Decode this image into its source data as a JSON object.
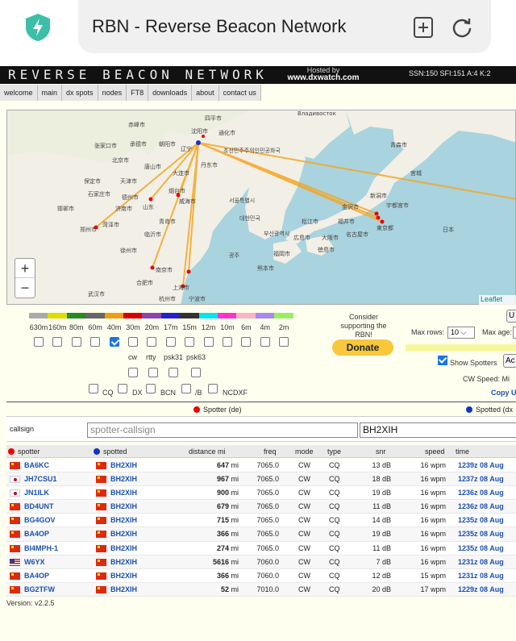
{
  "browser": {
    "title": "RBN - Reverse Beacon Network",
    "icons": {
      "shield": "shield-lightning-icon",
      "add_tab": "add-tab-icon",
      "reload": "reload-icon"
    }
  },
  "header": {
    "logo": "REVERSE BEACON NETWORK",
    "hosted_by": "Hosted by",
    "host": "www.dxwatch.com",
    "ssn": "SSN:150 SFI:151 A:4 K:2"
  },
  "nav": [
    "welcome",
    "main",
    "dx spots",
    "nodes",
    "FT8",
    "downloads",
    "about",
    "contact us"
  ],
  "map": {
    "zoom_in": "+",
    "zoom_out": "−",
    "attribution": "Leaflet",
    "places": [
      "赤峰市",
      "四平市",
      "沈阳市",
      "通化市",
      "承德市",
      "朝阳市",
      "张家口市",
      "北京市",
      "辽宁",
      "丹东市",
      "大连市",
      "唐山市",
      "天津市",
      "保定市",
      "石家庄市",
      "德州市",
      "济南市",
      "山东",
      "烟台市",
      "威海市",
      "青岛市",
      "邯郸市",
      "菏泽市",
      "临沂市",
      "郑州市",
      "徐州市",
      "南京市",
      "合肥市",
      "上海市",
      "杭州市",
      "宁波市",
      "武汉市",
      "서울특별시",
      "대한민국",
      "광주",
      "부산광역시",
      "新潟市",
      "金沢市",
      "福井市",
      "名古屋市",
      "東京都",
      "宇都宮市",
      "大阪市",
      "広島市",
      "熊本市",
      "福岡市",
      "松江市",
      "徳島市",
      "青森市",
      "宮城",
      "日本",
      "Владивосток",
      "조선민주주의인민공화국"
    ]
  },
  "bands": [
    {
      "label": "630m",
      "color": "#aaaaaa",
      "checked": false
    },
    {
      "label": "160m",
      "color": "#dddd00",
      "checked": false
    },
    {
      "label": "80m",
      "color": "#228b22",
      "checked": false
    },
    {
      "label": "60m",
      "color": "#666666",
      "checked": false
    },
    {
      "label": "40m",
      "color": "#f39c12",
      "checked": true
    },
    {
      "label": "30m",
      "color": "#dd0000",
      "checked": false
    },
    {
      "label": "20m",
      "color": "#8e44ad",
      "checked": false
    },
    {
      "label": "17m",
      "color": "#2222cc",
      "checked": false
    },
    {
      "label": "15m",
      "color": "#333333",
      "checked": false
    },
    {
      "label": "12m",
      "color": "#00e5ee",
      "checked": false
    },
    {
      "label": "10m",
      "color": "#ff33cc",
      "checked": false
    },
    {
      "label": "6m",
      "color": "#f7b6c2",
      "checked": false
    },
    {
      "label": "4m",
      "color": "#aa88ee",
      "checked": false
    },
    {
      "label": "2m",
      "color": "#99ee66",
      "checked": false
    }
  ],
  "modes": [
    "cw",
    "rtty",
    "psk31",
    "psk63"
  ],
  "options": [
    "CQ",
    "DX",
    "BCN",
    "/B",
    "NCDXF"
  ],
  "controls": {
    "consider": "Consider supporting the RBN!",
    "donate": "Donate",
    "max_rows_label": "Max rows:",
    "max_rows_value": "10",
    "max_age_label": "Max age:",
    "update_btn": "U",
    "show_spotters": "Show Spotters",
    "action_btn": "Ac",
    "cw_speed": "CW Speed:  Mi",
    "copy": "Copy U"
  },
  "filter": {
    "spotter_label": "Spotter (de)",
    "spotted_label": "Spotted (dx",
    "callsign_label": "callsign",
    "spotter_placeholder": "spotter-callsign",
    "spotted_value": "BH2XIH"
  },
  "table": {
    "headers": {
      "spotter": "spotter",
      "spotted": "spotted",
      "distance": "distance mi",
      "freq": "freq",
      "mode": "mode",
      "type": "type",
      "snr": "snr",
      "speed": "speed",
      "time": "time"
    },
    "rows": [
      {
        "spotter": "BA6KC",
        "flag1": "cn",
        "spotted": "BH2XIH",
        "flag2": "cn",
        "dist": "647",
        "unit": "mi",
        "freq": "7065.0",
        "mode": "CW",
        "type": "CQ",
        "snr": "13 dB",
        "speed": "16 wpm",
        "time": "1239z 08 Aug"
      },
      {
        "spotter": "JH7CSU1",
        "flag1": "jp",
        "spotted": "BH2XIH",
        "flag2": "cn",
        "dist": "967",
        "unit": "mi",
        "freq": "7065.0",
        "mode": "CW",
        "type": "CQ",
        "snr": "18 dB",
        "speed": "16 wpm",
        "time": "1237z 08 Aug"
      },
      {
        "spotter": "JN1ILK",
        "flag1": "jp",
        "spotted": "BH2XIH",
        "flag2": "cn",
        "dist": "900",
        "unit": "mi",
        "freq": "7065.0",
        "mode": "CW",
        "type": "CQ",
        "snr": "19 dB",
        "speed": "16 wpm",
        "time": "1236z 08 Aug"
      },
      {
        "spotter": "BD4UNT",
        "flag1": "cn",
        "spotted": "BH2XIH",
        "flag2": "cn",
        "dist": "679",
        "unit": "mi",
        "freq": "7065.0",
        "mode": "CW",
        "type": "CQ",
        "snr": "11 dB",
        "speed": "16 wpm",
        "time": "1236z 08 Aug"
      },
      {
        "spotter": "BG4GOV",
        "flag1": "cn",
        "spotted": "BH2XIH",
        "flag2": "cn",
        "dist": "715",
        "unit": "mi",
        "freq": "7065.0",
        "mode": "CW",
        "type": "CQ",
        "snr": "14 dB",
        "speed": "16 wpm",
        "time": "1235z 08 Aug"
      },
      {
        "spotter": "BA4OP",
        "flag1": "cn",
        "spotted": "BH2XIH",
        "flag2": "cn",
        "dist": "366",
        "unit": "mi",
        "freq": "7065.0",
        "mode": "CW",
        "type": "CQ",
        "snr": "19 dB",
        "speed": "16 wpm",
        "time": "1235z 08 Aug"
      },
      {
        "spotter": "BI4MPH-1",
        "flag1": "cn",
        "spotted": "BH2XIH",
        "flag2": "cn",
        "dist": "274",
        "unit": "mi",
        "freq": "7065.0",
        "mode": "CW",
        "type": "CQ",
        "snr": "11 dB",
        "speed": "16 wpm",
        "time": "1235z 08 Aug"
      },
      {
        "spotter": "W6YX",
        "flag1": "us",
        "spotted": "BH2XIH",
        "flag2": "cn",
        "dist": "5616",
        "unit": "mi",
        "freq": "7060.0",
        "mode": "CW",
        "type": "CQ",
        "snr": "7 dB",
        "speed": "16 wpm",
        "time": "1231z 08 Aug"
      },
      {
        "spotter": "BA4OP",
        "flag1": "cn",
        "spotted": "BH2XIH",
        "flag2": "cn",
        "dist": "366",
        "unit": "mi",
        "freq": "7060.0",
        "mode": "CW",
        "type": "CQ",
        "snr": "12 dB",
        "speed": "15 wpm",
        "time": "1231z 08 Aug"
      },
      {
        "spotter": "BG2TFW",
        "flag1": "cn",
        "spotted": "BH2XIH",
        "flag2": "cn",
        "dist": "52",
        "unit": "mi",
        "freq": "7010.0",
        "mode": "CW",
        "type": "CQ",
        "snr": "20 dB",
        "speed": "17 wpm",
        "time": "1229z 08 Aug"
      }
    ]
  },
  "version": "Version: v2.2.5"
}
